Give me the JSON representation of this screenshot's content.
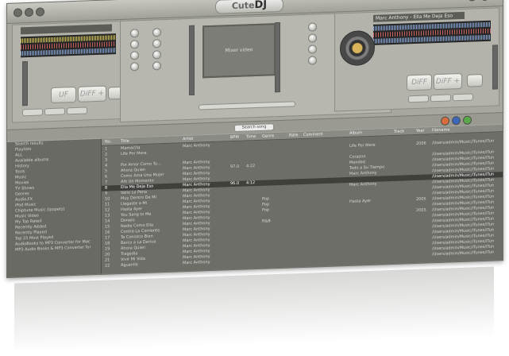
{
  "app": {
    "name_prefix": "Cute",
    "name_suffix": "DJ",
    "deck_left_title": "",
    "deck_right_title": "Marc Anthony - Ella Me Deja Eso",
    "video_caption": "Mixer video",
    "left_display": "UF",
    "right_display": "DiFF",
    "left_mode": "DiFF +",
    "right_mode": "DiFF +",
    "search_label": "Search song",
    "sidebar": {
      "items": [
        "Search results",
        "Playlists",
        "ALL",
        "Available albums",
        "History",
        "Tools",
        "Music",
        "Movies",
        "TV Shows",
        "Genres",
        "Audio.FX",
        "iPod Music",
        "Chiptune Music (Ipopetz)",
        "Music Video",
        "My Top Rated",
        "Recently Added",
        "Recently Played",
        "Top 25 Most Played",
        "AudioBooks to MP3 Converter for Mac",
        "MP3 Audio Books & MP3 Converter for"
      ]
    },
    "columns": [
      "No.",
      "Title",
      "Artist",
      "BPM",
      "Time",
      "Genre",
      "Rate",
      "Comment",
      "Album",
      "Track",
      "Year",
      "Filename"
    ],
    "rows": [
      [
        "1",
        "Mamacita",
        "Marc Anthony",
        "",
        "",
        "",
        "",
        "",
        "",
        "",
        "",
        ""
      ],
      [
        "2",
        "Life Por Mere",
        "",
        "",
        "",
        "",
        "",
        "",
        "Life Por Mere",
        "",
        "2006",
        "/Users/admin/Music/iTunes/iTun"
      ],
      [
        "3",
        "",
        "",
        "",
        "",
        "",
        "",
        "",
        "",
        "",
        "",
        ""
      ],
      [
        "4",
        "Por Amor Como Tu...",
        "Marc Anthony",
        "",
        "",
        "",
        "",
        "",
        "Corazon",
        "",
        "",
        "/Users/admin/Music/iTunes/iTun"
      ],
      [
        "5",
        "Ahora Quien",
        "Marc Anthony",
        "97.0",
        "4:22",
        "",
        "",
        "",
        "Mended",
        "",
        "",
        "/Users/admin/Music/iTunes/iTun"
      ],
      [
        "6",
        "Como Ama Una Mujer",
        "Marc Anthony",
        "",
        "",
        "",
        "",
        "",
        "Todo a Su Tiempo",
        "",
        "",
        "/Users/admin/Music/iTunes/iTun"
      ],
      [
        "7",
        "Alti Un Momento",
        "Marc Anthony",
        "",
        "",
        "",
        "",
        "",
        "Marc Anthony",
        "",
        "",
        "/Users/admin/Music/iTunes/iTun"
      ],
      [
        "8",
        "Ella Me Deja Eso",
        "Marc Anthony",
        "96.0",
        "4:12",
        "",
        "",
        "",
        "",
        "",
        "",
        "/Users/admin/Music/iTunes/iTun"
      ],
      [
        "9",
        "Valio La Pena",
        "Marc Anthony",
        "",
        "",
        "",
        "",
        "",
        "Marc Anthony",
        "",
        "",
        "/Users/admin/Music/iTunes/iTun"
      ],
      [
        "10",
        "Muy Dentro De Mi",
        "Marc Anthony",
        "",
        "",
        "",
        "",
        "",
        "",
        "",
        "",
        "/Users/admin/Music/iTunes/iTun"
      ],
      [
        "11",
        "Llegaste a Mi",
        "Marc Anthony",
        "",
        "",
        "Pop",
        "",
        "",
        "",
        "",
        "",
        "/Users/admin/Music/iTunes/iTun"
      ],
      [
        "12",
        "Hasta Ayer",
        "Marc Anthony",
        "",
        "",
        "Pop",
        "",
        "",
        "Hasta Ayer",
        "",
        "2005",
        "/Users/admin/Music/iTunes/iTun"
      ],
      [
        "13",
        "You Sang to Me",
        "Marc Anthony",
        "",
        "",
        "Pop",
        "",
        "",
        "",
        "",
        "",
        "/Users/admin/Music/iTunes/iTun"
      ],
      [
        "14",
        "Dimelo",
        "Marc Anthony",
        "",
        "",
        "",
        "",
        "",
        "",
        "",
        "2003",
        "/Users/admin/Music/iTunes/iTun"
      ],
      [
        "15",
        "Nadie Como Ella",
        "Marc Anthony",
        "",
        "",
        "R&B",
        "",
        "",
        "",
        "",
        "",
        "/Users/admin/Music/iTunes/iTun"
      ],
      [
        "16",
        "Contra La Corriente",
        "Marc Anthony",
        "",
        "",
        "",
        "",
        "",
        "",
        "",
        "",
        "/Users/admin/Music/iTunes/iTun"
      ],
      [
        "17",
        "Te Conozco Bien",
        "Marc Anthony",
        "",
        "",
        "",
        "",
        "",
        "",
        "",
        "",
        "/Users/admin/Music/iTunes/iTun"
      ],
      [
        "18",
        "Barco a La Deriva",
        "Marc Anthony",
        "",
        "",
        "",
        "",
        "",
        "",
        "",
        "",
        "/Users/admin/Music/iTunes/iTun"
      ],
      [
        "19",
        "Ahora Quien",
        "Marc Anthony",
        "",
        "",
        "",
        "",
        "",
        "",
        "",
        "",
        "/Users/admin/Music/iTunes/iTun"
      ],
      [
        "20",
        "Tragedia",
        "Marc Anthony",
        "",
        "",
        "",
        "",
        "",
        "",
        "",
        "",
        "/Users/admin/Music/iTunes/iTun"
      ],
      [
        "21",
        "Vivir Mi Vida",
        "Marc Anthony",
        "",
        "",
        "",
        "",
        "",
        "",
        "",
        "",
        "/Users/admin/Music/iTunes/iTun"
      ],
      [
        "22",
        "Aguanile",
        "Marc Anthony",
        "",
        "",
        "",
        "",
        "",
        "",
        "",
        "",
        "/Users/admin/Music/iTunes/iTun"
      ]
    ]
  },
  "colors": {
    "frame": "#a7a7a0",
    "browser": "#6e6e69",
    "selected_row": "#3f3f3b",
    "accent_gold": "#d9b45a",
    "wave_green": "#d3c55c",
    "wave_blue": "#8ba8d6",
    "wave_red": "#c86060"
  }
}
